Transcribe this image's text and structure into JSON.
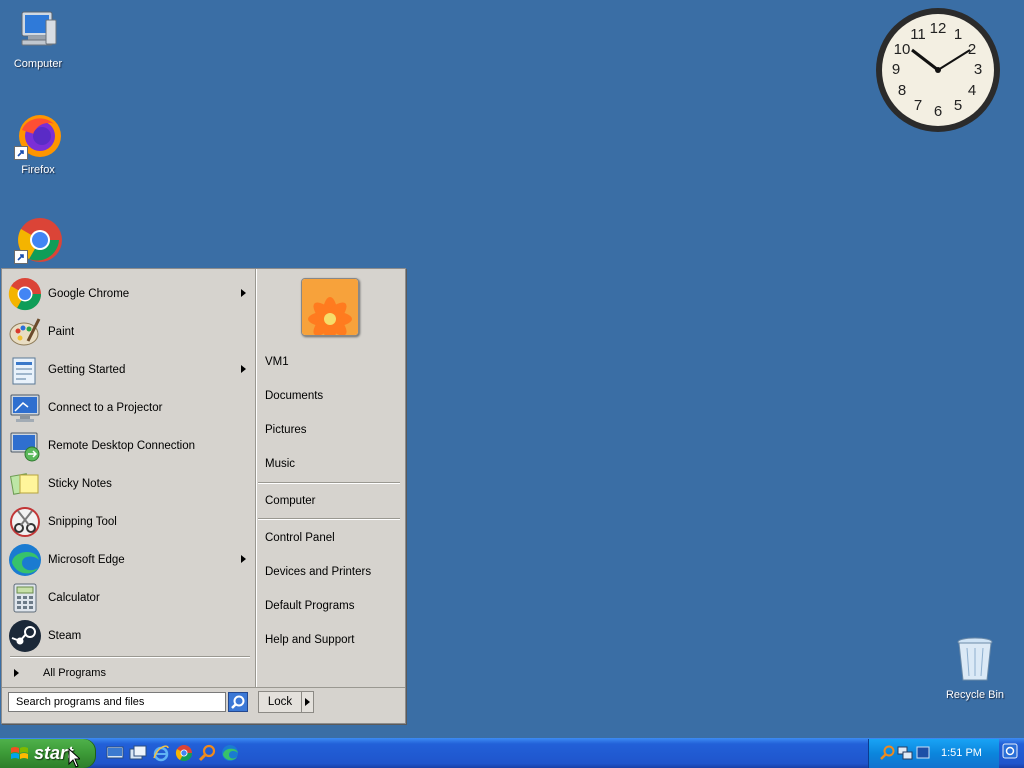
{
  "desktop": {
    "icons": [
      {
        "label": "Computer"
      },
      {
        "label": "Firefox"
      },
      {
        "label": ""
      }
    ],
    "recycle_bin": "Recycle Bin"
  },
  "clock": {
    "time": "1:51"
  },
  "start_menu": {
    "programs": [
      {
        "label": "Google Chrome",
        "icon": "chrome-icon",
        "submenu": true
      },
      {
        "label": "Paint",
        "icon": "paint-icon",
        "submenu": false
      },
      {
        "label": "Getting Started",
        "icon": "getting-started-icon",
        "submenu": true
      },
      {
        "label": "Connect to a Projector",
        "icon": "projector-icon",
        "submenu": false
      },
      {
        "label": "Remote Desktop Connection",
        "icon": "remote-desktop-icon",
        "submenu": false
      },
      {
        "label": "Sticky Notes",
        "icon": "sticky-notes-icon",
        "submenu": false
      },
      {
        "label": "Snipping Tool",
        "icon": "snipping-tool-icon",
        "submenu": false
      },
      {
        "label": "Microsoft Edge",
        "icon": "edge-icon",
        "submenu": true
      },
      {
        "label": "Calculator",
        "icon": "calculator-icon",
        "submenu": false
      },
      {
        "label": "Steam",
        "icon": "steam-icon",
        "submenu": false
      }
    ],
    "all_programs": "All Programs",
    "search_placeholder": "Search programs and files",
    "lock_label": "Lock",
    "right": {
      "user": "VM1",
      "group1": [
        "Documents",
        "Pictures",
        "Music"
      ],
      "group2": [
        "Computer"
      ],
      "group3": [
        "Control Panel",
        "Devices and Printers",
        "Default Programs",
        "Help and Support"
      ]
    }
  },
  "taskbar": {
    "start_label": "start",
    "time": "1:51 PM"
  }
}
